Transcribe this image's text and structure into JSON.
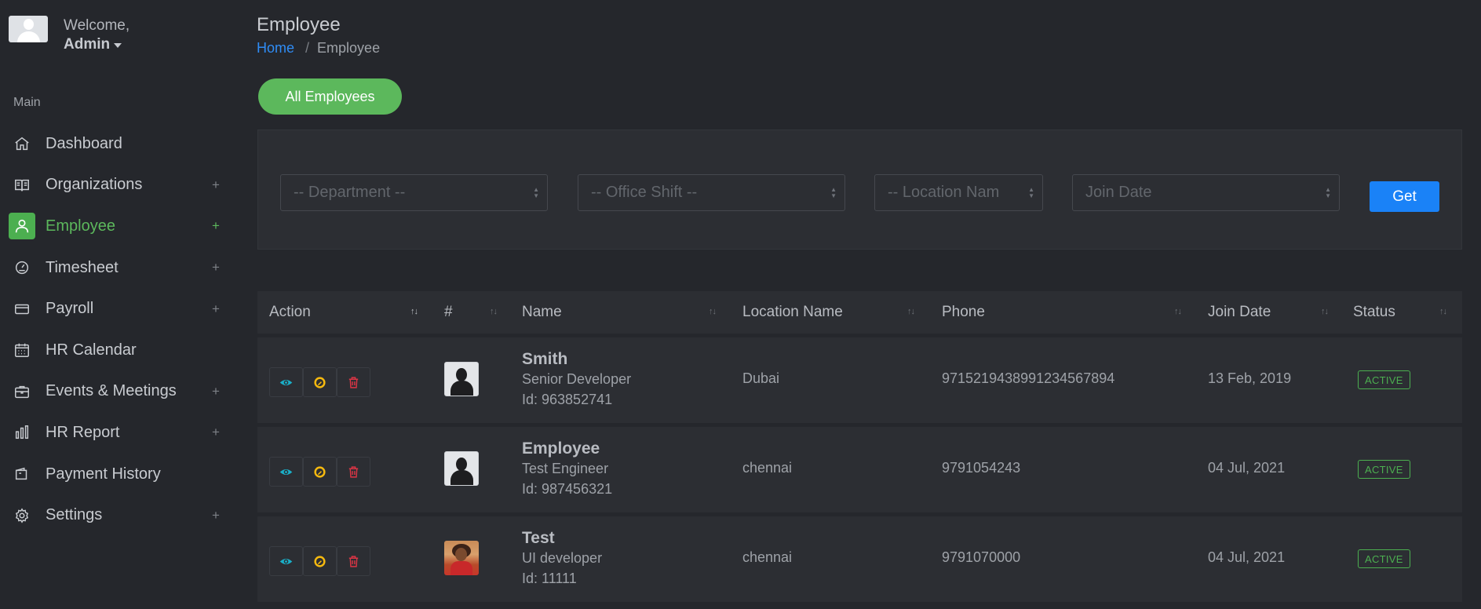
{
  "user": {
    "welcome": "Welcome,",
    "name": "Admin"
  },
  "sidebar": {
    "section_title": "Main",
    "items": [
      {
        "label": "Dashboard",
        "icon": "home-icon",
        "plus": ""
      },
      {
        "label": "Organizations",
        "icon": "book-icon",
        "plus": "+"
      },
      {
        "label": "Employee",
        "icon": "user-icon",
        "plus": "+"
      },
      {
        "label": "Timesheet",
        "icon": "gauge-icon",
        "plus": "+"
      },
      {
        "label": "Payroll",
        "icon": "credit-card-icon",
        "plus": "+"
      },
      {
        "label": "HR Calendar",
        "icon": "calendar-icon",
        "plus": ""
      },
      {
        "label": "Events & Meetings",
        "icon": "briefcase-icon",
        "plus": "+"
      },
      {
        "label": "HR Report",
        "icon": "bar-chart-icon",
        "plus": "+"
      },
      {
        "label": "Payment History",
        "icon": "wallet-icon",
        "plus": ""
      },
      {
        "label": "Settings",
        "icon": "gear-icon",
        "plus": "+"
      }
    ],
    "active_index": 2
  },
  "header": {
    "title": "Employee",
    "breadcrumb_home": "Home",
    "breadcrumb_sep": "/",
    "breadcrumb_current": "Employee"
  },
  "all_employees_label": "All Employees",
  "filters": {
    "department": "-- Department --",
    "office_shift": "-- Office Shift --",
    "location": "-- Location Nam",
    "join_date": "Join Date",
    "get_label": "Get"
  },
  "table": {
    "columns": [
      "Action",
      "#",
      "Name",
      "Location Name",
      "Phone",
      "Join Date",
      "Status"
    ],
    "rows": [
      {
        "name": "Smith",
        "role": "Senior Developer",
        "id": "Id: 963852741",
        "location": "Dubai",
        "phone": "971521943899123456789​4",
        "join_date": "13 Feb, 2019",
        "status": "ACTIVE"
      },
      {
        "name": "Employee",
        "role": "Test Engineer",
        "id": "Id: 987456321",
        "location": "chennai",
        "phone": "9791054243",
        "join_date": "04 Jul, 2021",
        "status": "ACTIVE"
      },
      {
        "name": "Test",
        "role": "UI developer",
        "id": "Id: 11111",
        "location": "chennai",
        "phone": "9791070000",
        "join_date": "04 Jul, 2021",
        "status": "ACTIVE"
      }
    ]
  },
  "colors": {
    "accent_green": "#5cb85c",
    "primary_blue": "#1a82f7",
    "view_icon": "#1ab0c9",
    "edit_icon": "#f5b90f",
    "delete_icon": "#dc3545"
  }
}
